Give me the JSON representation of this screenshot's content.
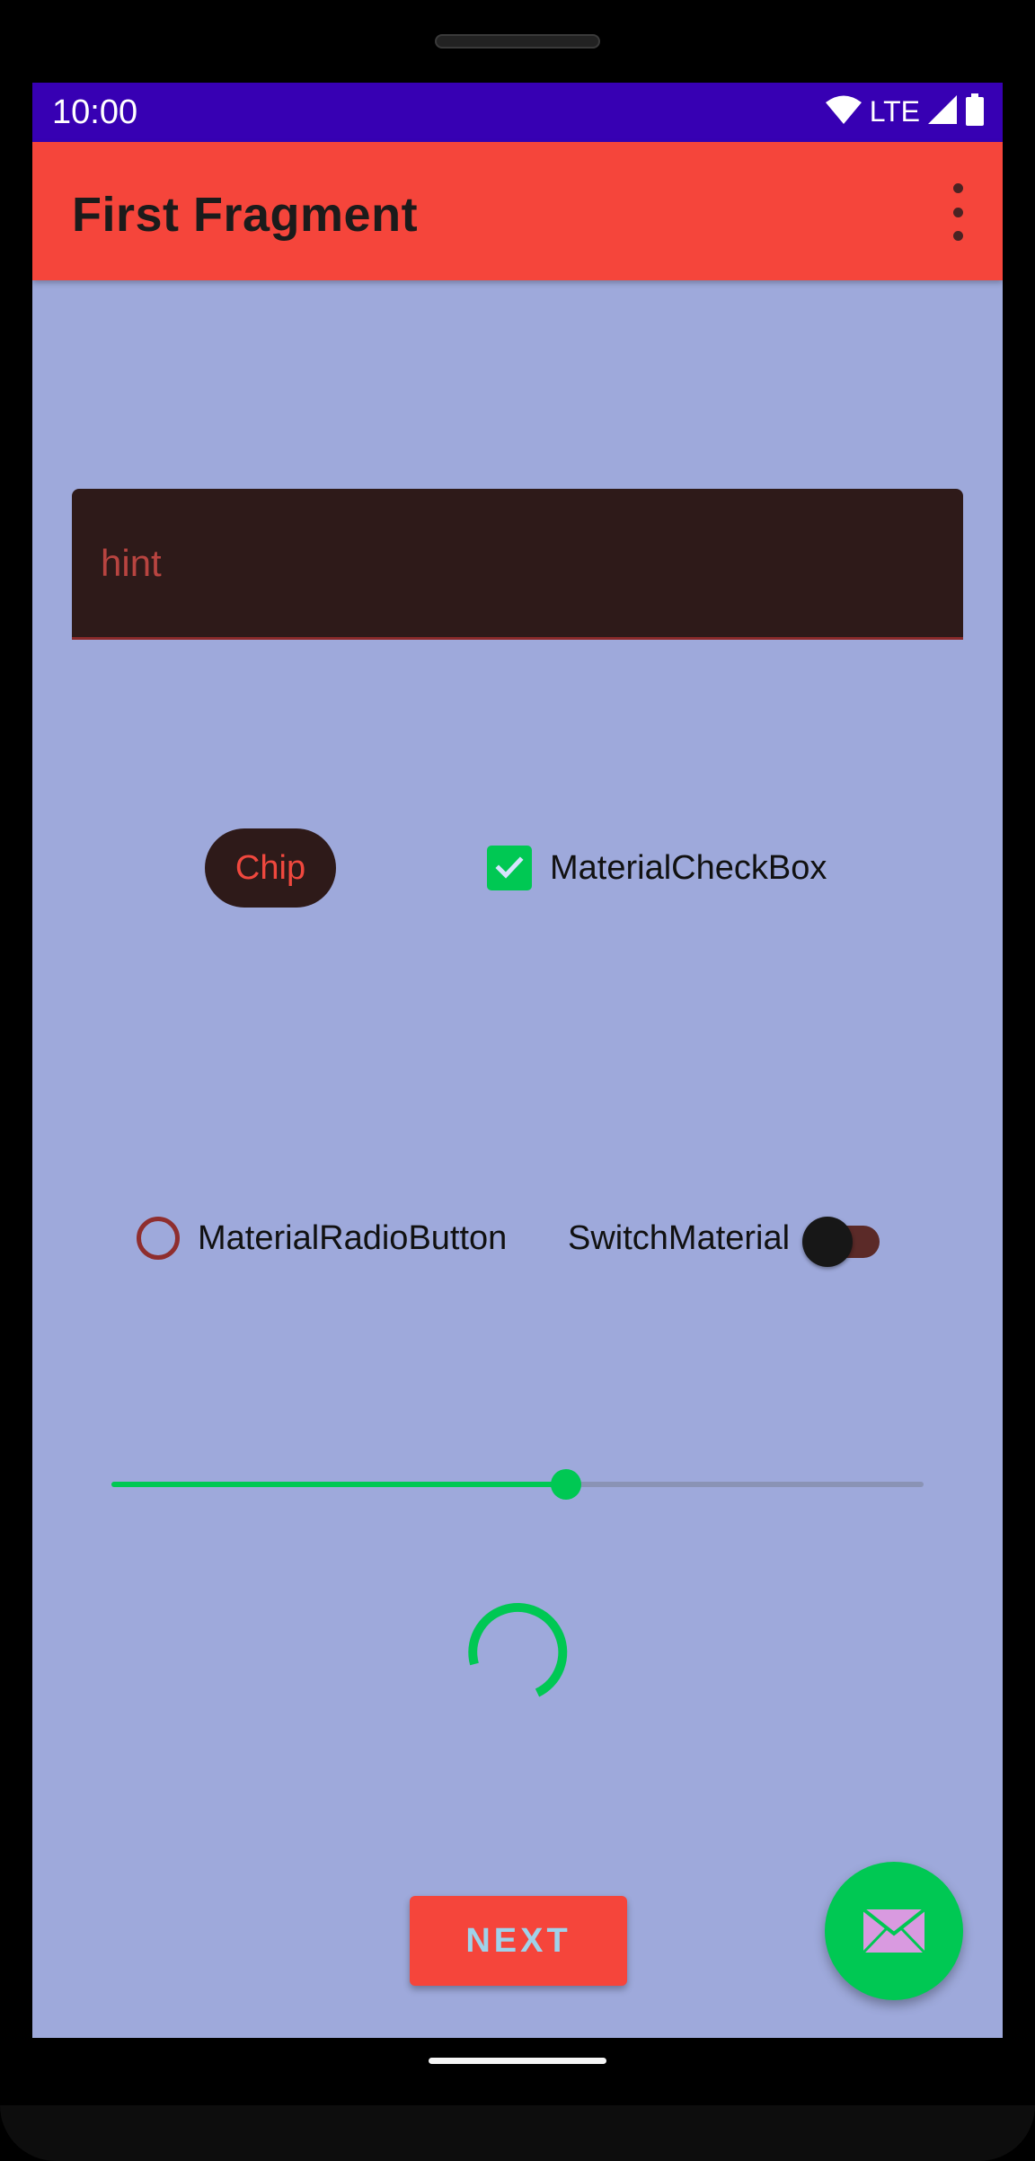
{
  "status_bar": {
    "time": "10:00",
    "network": "LTE"
  },
  "app_bar": {
    "title": "First Fragment"
  },
  "text_field": {
    "placeholder": "hint"
  },
  "chip": {
    "label": "Chip"
  },
  "checkbox": {
    "label": "MaterialCheckBox",
    "checked": true
  },
  "radio": {
    "label": "MaterialRadioButton",
    "checked": false
  },
  "switch": {
    "label": "SwitchMaterial",
    "on": false
  },
  "slider": {
    "value_fraction": 0.56
  },
  "progress": {
    "type": "indeterminate-circular"
  },
  "next_button": {
    "label": "NEXT"
  },
  "fab": {
    "icon": "mail-icon"
  },
  "colors": {
    "status_bar": "#3700b3",
    "app_bar": "#f5453b",
    "background": "#9ea9db",
    "accent": "#00c853",
    "field": "#2e1a19"
  }
}
